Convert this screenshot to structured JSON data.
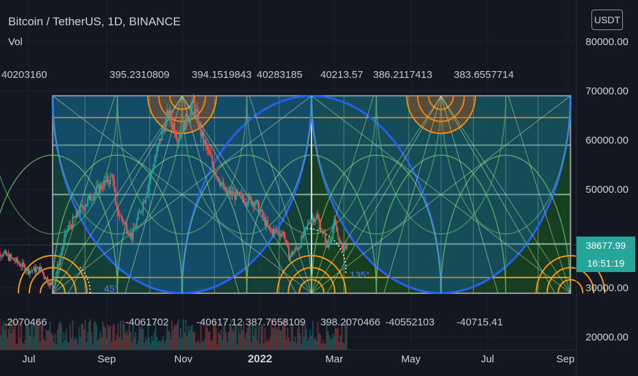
{
  "header": {
    "title": "Bitcoin / TetherUS, 1D, BINANCE",
    "indicator": "Vol",
    "currency": "USDT"
  },
  "last_price": {
    "price": "38677.99",
    "countdown": "16:51:19"
  },
  "colors": {
    "background": "#131722",
    "up": "#26a69a",
    "down": "#ef5350",
    "arc_blue": "#2962ff",
    "arc_orange": "#ff9800",
    "arc_green": "#66bb6a",
    "box_border": "#9e9e9e",
    "last_price_line": "#26a69a"
  },
  "chart_data": {
    "type": "candlestick",
    "title": "Bitcoin / TetherUS, 1D, BINANCE",
    "xlabel": "",
    "ylabel": "",
    "x_tick_labels": [
      "Jul",
      "Sep",
      "Nov",
      "2022",
      "Mar",
      "May",
      "Jul",
      "Sep"
    ],
    "x_tick_dates": [
      "2021-07-01",
      "2021-09-01",
      "2021-11-01",
      "2022-01-01",
      "2022-03-01",
      "2022-05-01",
      "2022-07-01",
      "2022-09-01"
    ],
    "y_ticks": [
      20000,
      30000,
      40000,
      50000,
      60000,
      70000,
      80000
    ],
    "y_tick_labels": [
      "20000.00",
      "30000.00",
      "40000.00",
      "50000.00",
      "60000.00",
      "70000.00",
      "80000.00"
    ],
    "ylim": [
      18500,
      82000
    ],
    "price_scale": "linear",
    "last_price": 38677.99,
    "close_series": [
      {
        "date": "2021-06-01",
        "close": 37500
      },
      {
        "date": "2021-06-10",
        "close": 37000
      },
      {
        "date": "2021-06-20",
        "close": 35500
      },
      {
        "date": "2021-07-01",
        "close": 33500
      },
      {
        "date": "2021-07-10",
        "close": 33800
      },
      {
        "date": "2021-07-20",
        "close": 30000
      },
      {
        "date": "2021-07-31",
        "close": 41500
      },
      {
        "date": "2021-08-10",
        "close": 45500
      },
      {
        "date": "2021-08-22",
        "close": 49300
      },
      {
        "date": "2021-09-06",
        "close": 52700
      },
      {
        "date": "2021-09-08",
        "close": 46200
      },
      {
        "date": "2021-09-21",
        "close": 40500
      },
      {
        "date": "2021-10-01",
        "close": 48200
      },
      {
        "date": "2021-10-15",
        "close": 61500
      },
      {
        "date": "2021-10-20",
        "close": 65500
      },
      {
        "date": "2021-10-28",
        "close": 60500
      },
      {
        "date": "2021-11-09",
        "close": 67500
      },
      {
        "date": "2021-11-16",
        "close": 60500
      },
      {
        "date": "2021-11-26",
        "close": 54000
      },
      {
        "date": "2021-12-04",
        "close": 49500
      },
      {
        "date": "2021-12-15",
        "close": 48500
      },
      {
        "date": "2021-12-28",
        "close": 47500
      },
      {
        "date": "2022-01-08",
        "close": 41800
      },
      {
        "date": "2022-01-20",
        "close": 41000
      },
      {
        "date": "2022-01-24",
        "close": 36300
      },
      {
        "date": "2022-02-01",
        "close": 38500
      },
      {
        "date": "2022-02-10",
        "close": 44000
      },
      {
        "date": "2022-02-15",
        "close": 44500
      },
      {
        "date": "2022-02-24",
        "close": 38300
      },
      {
        "date": "2022-03-01",
        "close": 43000
      },
      {
        "date": "2022-03-07",
        "close": 38000
      },
      {
        "date": "2022-03-11",
        "close": 38700
      }
    ],
    "drawing": {
      "type": "gann_box_with_arcs",
      "start_date": "2021-07-20",
      "end_date": "2022-09-05",
      "price_low": 28900,
      "price_high": 69000,
      "angle_labels": [
        "45°",
        "135°"
      ],
      "top_labels": [
        "40203160",
        "395.2310809",
        "394.1519843",
        "40283185",
        "40213.57",
        "386.2117413",
        "383.6557714"
      ],
      "bottom_labels": [
        ".2070466",
        "-4061702",
        "-40617.12 387.7658109",
        "398.2070466",
        "-40552103",
        "-40715.41"
      ]
    },
    "series": [
      {
        "name": "Vol"
      }
    ]
  }
}
